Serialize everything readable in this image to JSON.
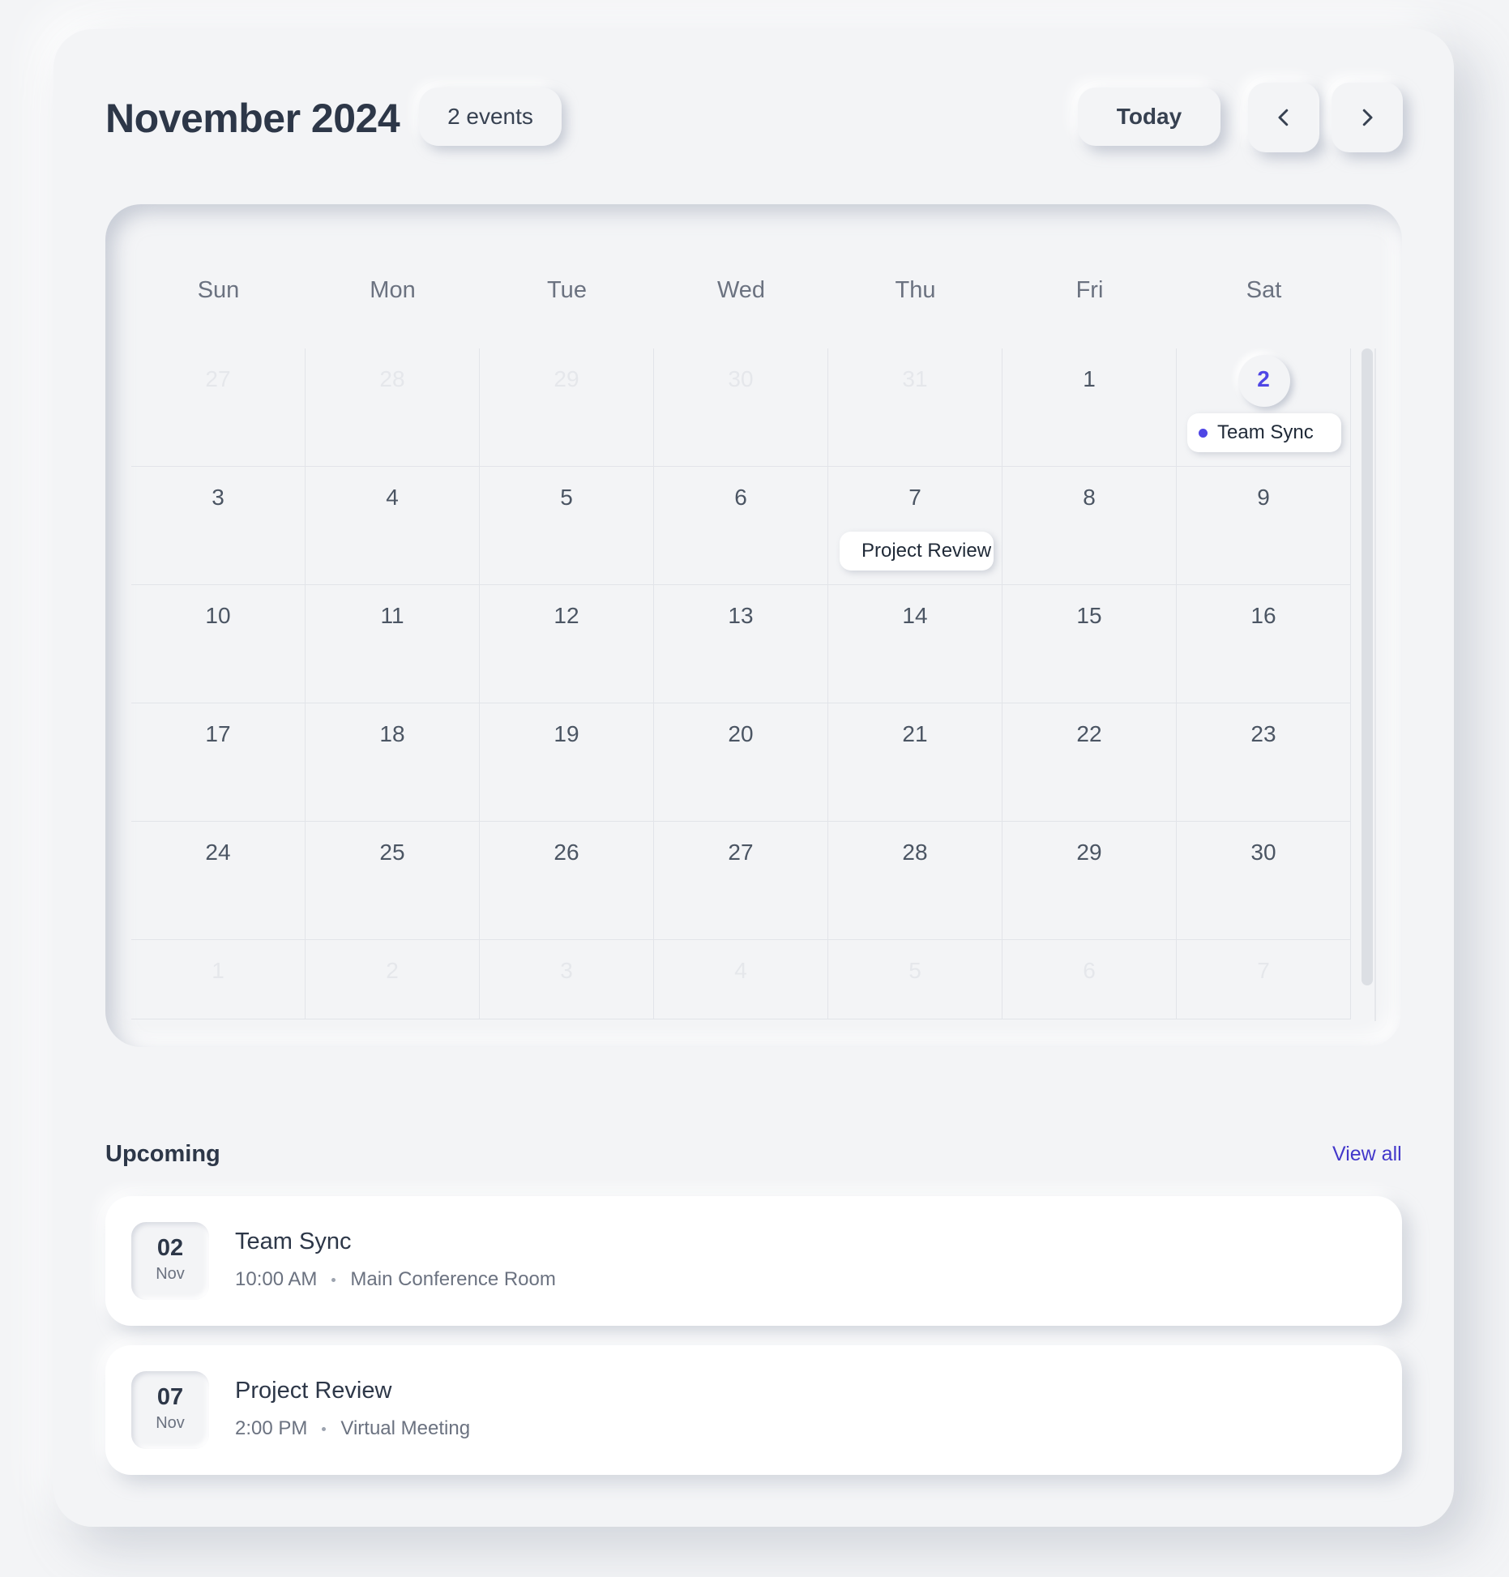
{
  "header": {
    "month_title": "November 2024",
    "events_count": "2 events",
    "today_label": "Today",
    "prev_icon": "chevron-left-icon",
    "next_icon": "chevron-right-icon"
  },
  "calendar": {
    "weekdays": [
      "Sun",
      "Mon",
      "Tue",
      "Wed",
      "Thu",
      "Fri",
      "Sat"
    ],
    "weeks": [
      [
        {
          "n": "27",
          "muted": true
        },
        {
          "n": "28",
          "muted": true
        },
        {
          "n": "29",
          "muted": true
        },
        {
          "n": "30",
          "muted": true
        },
        {
          "n": "31",
          "muted": true
        },
        {
          "n": "1"
        },
        {
          "n": "2",
          "today": true,
          "event": "Team Sync"
        }
      ],
      [
        {
          "n": "3"
        },
        {
          "n": "4"
        },
        {
          "n": "5"
        },
        {
          "n": "6"
        },
        {
          "n": "7",
          "event": "Project Review"
        },
        {
          "n": "8"
        },
        {
          "n": "9"
        }
      ],
      [
        {
          "n": "10"
        },
        {
          "n": "11"
        },
        {
          "n": "12"
        },
        {
          "n": "13"
        },
        {
          "n": "14"
        },
        {
          "n": "15"
        },
        {
          "n": "16"
        }
      ],
      [
        {
          "n": "17"
        },
        {
          "n": "18"
        },
        {
          "n": "19"
        },
        {
          "n": "20"
        },
        {
          "n": "21"
        },
        {
          "n": "22"
        },
        {
          "n": "23"
        }
      ],
      [
        {
          "n": "24"
        },
        {
          "n": "25"
        },
        {
          "n": "26"
        },
        {
          "n": "27"
        },
        {
          "n": "28"
        },
        {
          "n": "29"
        },
        {
          "n": "30"
        }
      ],
      [
        {
          "n": "1",
          "muted": true
        },
        {
          "n": "2",
          "muted": true
        },
        {
          "n": "3",
          "muted": true
        },
        {
          "n": "4",
          "muted": true
        },
        {
          "n": "5",
          "muted": true
        },
        {
          "n": "6",
          "muted": true
        },
        {
          "n": "7",
          "muted": true
        }
      ]
    ],
    "accent_color": "#4f46e5"
  },
  "upcoming": {
    "label": "Upcoming",
    "view_all": "View all",
    "items": [
      {
        "day": "02",
        "month": "Nov",
        "title": "Team Sync",
        "time": "10:00 AM",
        "location": "Main Conference Room"
      },
      {
        "day": "07",
        "month": "Nov",
        "title": "Project Review",
        "time": "2:00 PM",
        "location": "Virtual Meeting"
      }
    ]
  }
}
